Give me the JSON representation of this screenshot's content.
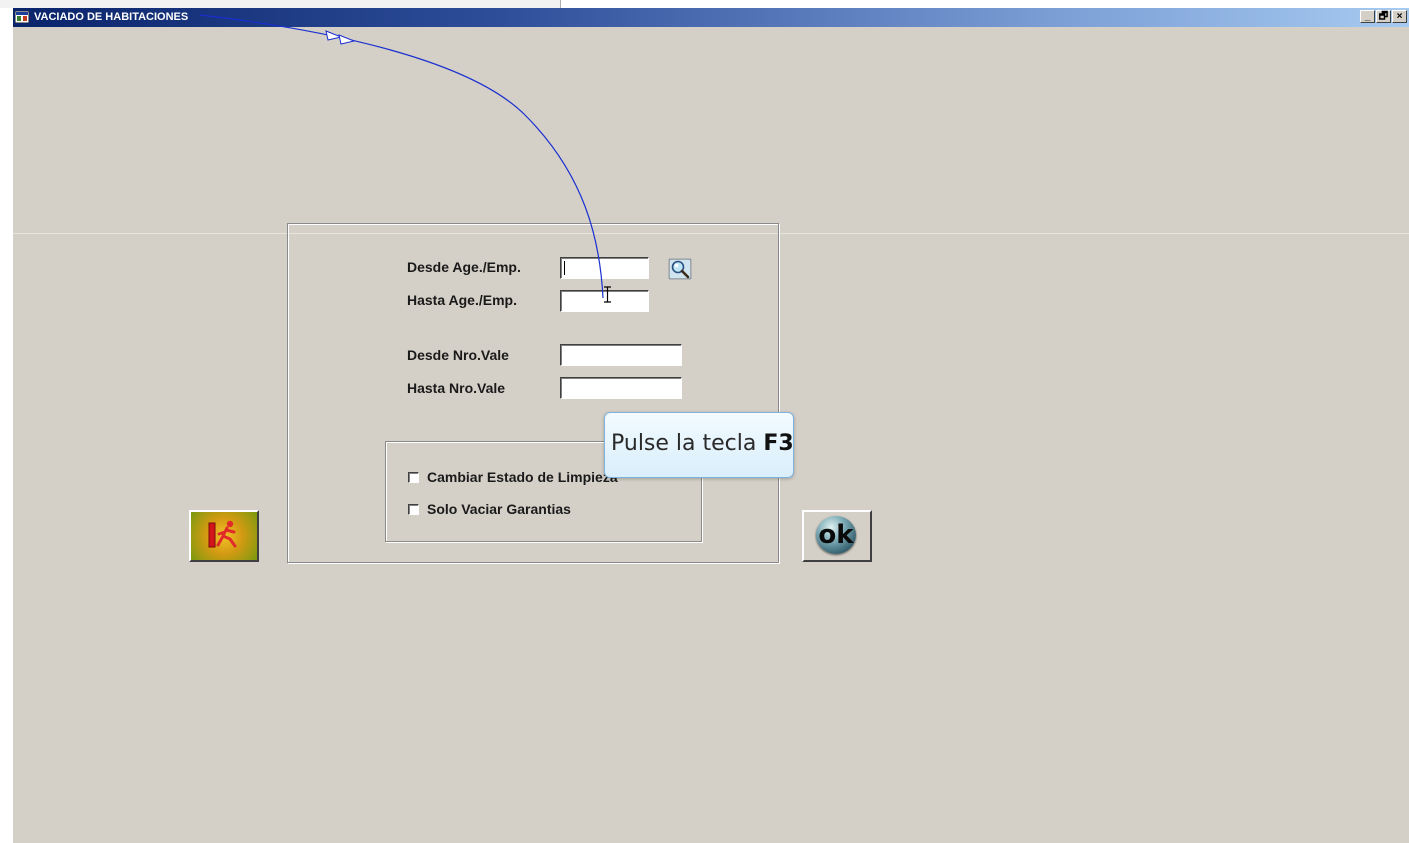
{
  "window": {
    "title": "VACIADO DE HABITACIONES",
    "controls": {
      "minimize": "_",
      "maximize": "🗗",
      "close": "×"
    }
  },
  "form": {
    "fields": [
      {
        "label": "Desde Age./Emp.",
        "value": ""
      },
      {
        "label": "Hasta Age./Emp.",
        "value": ""
      },
      {
        "label": "Desde Nro.Vale",
        "value": ""
      },
      {
        "label": "Hasta Nro.Vale",
        "value": ""
      }
    ],
    "options": [
      {
        "label": "Cambiar Estado de Limpieza",
        "checked": false
      },
      {
        "label": "Solo Vaciar Garantias",
        "checked": false
      }
    ]
  },
  "buttons": {
    "ok": "ok"
  },
  "tooltip": {
    "prefix": "Pulse la tecla ",
    "key": "F3"
  },
  "icons": {
    "app": "app-window-icon",
    "lookup": "magnifier-icon",
    "exit": "exit-door-runner-icon",
    "ok": "ok-orb-icon",
    "cursor": "text-cursor-icon"
  },
  "colors": {
    "titlebar_start": "#0a246a",
    "titlebar_end": "#a6caf0",
    "window_bg": "#d4d0c8",
    "annotation_arrow": "#1a2fd0"
  }
}
